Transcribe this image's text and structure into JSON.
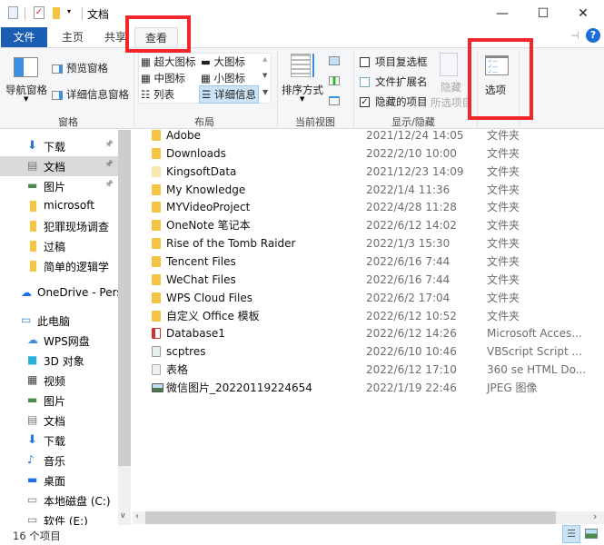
{
  "window": {
    "title": "文档",
    "minimize": "—",
    "maximize": "☐",
    "close": "✕",
    "help": "?"
  },
  "tabs": [
    "文件",
    "主页",
    "共享",
    "查看"
  ],
  "ribbon": {
    "panes": {
      "nav_pane": "导航窗格",
      "preview_pane": "预览窗格",
      "details_pane": "详细信息窗格",
      "group": "窗格"
    },
    "layout": {
      "items": [
        "超大图标",
        "大图标",
        "中图标",
        "小图标",
        "列表",
        "详细信息"
      ],
      "selected": "详细信息",
      "group": "布局"
    },
    "current_view": {
      "sort": "排序方式",
      "group": "当前视图"
    },
    "show_hide": {
      "item_checkboxes": {
        "label": "项目复选框",
        "checked": false
      },
      "file_extensions": {
        "label": "文件扩展名",
        "checked": false
      },
      "hidden_items": {
        "label": "隐藏的项目",
        "checked": true
      },
      "hide_selected": "隐藏",
      "hide_selected2": "所选项目",
      "group": "显示/隐藏"
    },
    "options": "选项"
  },
  "sidebar": {
    "items": [
      {
        "label": "下载",
        "icon": "download-icon",
        "pinned": true
      },
      {
        "label": "文档",
        "icon": "document-icon",
        "pinned": true,
        "selected": true
      },
      {
        "label": "图片",
        "icon": "picture-icon",
        "pinned": true
      },
      {
        "label": "microsoft",
        "icon": "folder-icon"
      },
      {
        "label": "犯罪现场调查",
        "icon": "folder-icon"
      },
      {
        "label": "过稿",
        "icon": "folder-icon"
      },
      {
        "label": "简单的逻辑学",
        "icon": "folder-icon"
      },
      {
        "label": "OneDrive - Perso",
        "icon": "cloud-icon"
      },
      {
        "label": "此电脑",
        "icon": "computer-icon"
      },
      {
        "label": "WPS网盘",
        "icon": "wps-cloud-icon"
      },
      {
        "label": "3D 对象",
        "icon": "3d-objects-icon"
      },
      {
        "label": "视频",
        "icon": "video-icon"
      },
      {
        "label": "图片",
        "icon": "picture-icon"
      },
      {
        "label": "文档",
        "icon": "document-icon"
      },
      {
        "label": "下载",
        "icon": "download-icon"
      },
      {
        "label": "音乐",
        "icon": "music-icon"
      },
      {
        "label": "桌面",
        "icon": "desktop-icon"
      },
      {
        "label": "本地磁盘 (C:)",
        "icon": "drive-icon"
      },
      {
        "label": "软件 (E:)",
        "icon": "drive-icon"
      }
    ]
  },
  "files": [
    {
      "name": "Adobe",
      "date": "2021/12/24 14:05",
      "type": "文件夹",
      "icon": "folder"
    },
    {
      "name": "Downloads",
      "date": "2022/2/10 10:00",
      "type": "文件夹",
      "icon": "folder"
    },
    {
      "name": "KingsoftData",
      "date": "2021/12/23 14:09",
      "type": "文件夹",
      "icon": "folder-faded"
    },
    {
      "name": "My Knowledge",
      "date": "2022/1/4 11:36",
      "type": "文件夹",
      "icon": "folder"
    },
    {
      "name": "MYVideoProject",
      "date": "2022/4/28 11:28",
      "type": "文件夹",
      "icon": "folder"
    },
    {
      "name": "OneNote 笔记本",
      "date": "2022/6/12 14:02",
      "type": "文件夹",
      "icon": "folder"
    },
    {
      "name": "Rise of the Tomb Raider",
      "date": "2022/1/3 15:30",
      "type": "文件夹",
      "icon": "folder"
    },
    {
      "name": "Tencent Files",
      "date": "2022/6/16 7:44",
      "type": "文件夹",
      "icon": "folder"
    },
    {
      "name": "WeChat Files",
      "date": "2022/6/16 7:44",
      "type": "文件夹",
      "icon": "folder"
    },
    {
      "name": "WPS Cloud Files",
      "date": "2022/6/2 17:04",
      "type": "文件夹",
      "icon": "folder"
    },
    {
      "name": "自定义 Office 模板",
      "date": "2022/6/12 10:52",
      "type": "文件夹",
      "icon": "folder"
    },
    {
      "name": "Database1",
      "date": "2022/6/12 14:26",
      "type": "Microsoft Acces...",
      "icon": "access"
    },
    {
      "name": "scptres",
      "date": "2022/6/10 10:46",
      "type": "VBScript Script ...",
      "icon": "script"
    },
    {
      "name": "表格",
      "date": "2022/6/12 17:10",
      "type": "360 se HTML Do...",
      "icon": "html"
    },
    {
      "name": "微信图片_20220119224654",
      "date": "2022/1/19 22:46",
      "type": "JPEG 图像",
      "icon": "image"
    }
  ],
  "status": {
    "count": "16 个项目"
  },
  "colors": {
    "accent": "#1a5fb4",
    "highlight_box": "#f2262b",
    "folder": "#f6c443"
  }
}
